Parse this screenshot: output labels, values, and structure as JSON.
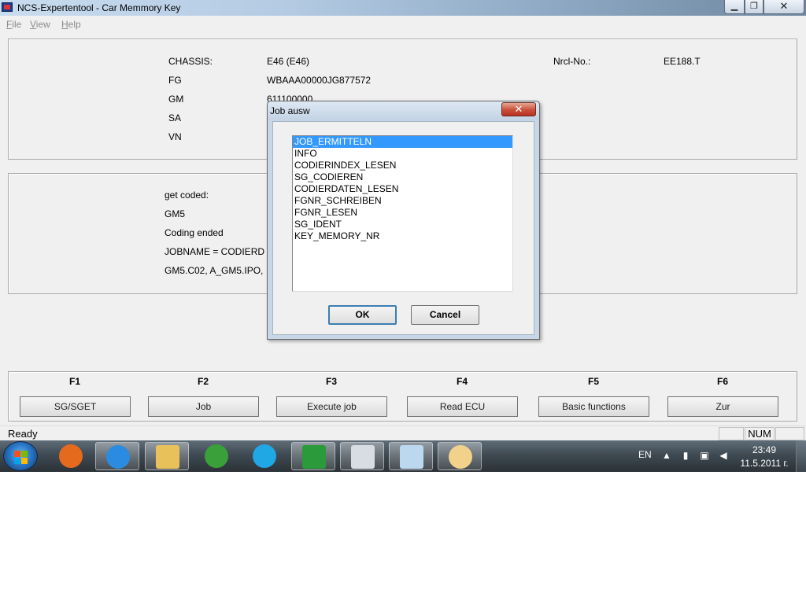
{
  "window": {
    "title": "NCS-Expertentool - Car Memmory Key",
    "min_glyph": "▁",
    "max_glyph": "❐",
    "close_glyph": "✕"
  },
  "menu": {
    "file": {
      "accel": "F",
      "rest": "ile"
    },
    "view": {
      "accel": "V",
      "rest": "iew"
    },
    "help": {
      "accel": "H",
      "rest": "elp"
    }
  },
  "vehicle_info": {
    "chassis_label": "CHASSIS:",
    "chassis_value": "E46 (E46)",
    "fg_label": "FG",
    "fg_value": "WBAAA00000JG877572",
    "gm_label": "GM",
    "gm_value": "611100000",
    "sa_label": "SA",
    "vn_label": "VN",
    "nrcl_label": "Nrcl-No.:",
    "nrcl_value": "EE188.T"
  },
  "log": {
    "line1": "get coded:",
    "line2": "GM5",
    "line3": "Coding ended",
    "line4": "JOBNAME = CODIERD",
    "line5": "GM5.C02, A_GM5.IPO,"
  },
  "function_keys": [
    {
      "key": "F1",
      "label": "SG/SGET"
    },
    {
      "key": "F2",
      "label": "Job"
    },
    {
      "key": "F3",
      "label": "Execute job"
    },
    {
      "key": "F4",
      "label": "Read ECU"
    },
    {
      "key": "F5",
      "label": "Basic functions"
    },
    {
      "key": "F6",
      "label": "Zur"
    }
  ],
  "status": {
    "text": "Ready",
    "num": "NUM"
  },
  "dialog": {
    "title": "Job ausw",
    "close_glyph": "✕",
    "selected_job": "JOB_ERMITTELN",
    "jobs": [
      "JOB_ERMITTELN",
      "INFO",
      "CODIERINDEX_LESEN",
      "SG_CODIEREN",
      "CODIERDATEN_LESEN",
      "FGNR_SCHREIBEN",
      "FGNR_LESEN",
      "SG_IDENT",
      "KEY_MEMORY_NR"
    ],
    "ok_label": "OK",
    "cancel_label": "Cancel"
  },
  "taskbar": {
    "apps": [
      "firefox-icon",
      "internet-explorer-icon",
      "explorer-folder-icon",
      "utorrent-icon",
      "skype-icon",
      "diagnostic-tool-icon",
      "calculator-icon",
      "notepad-icon",
      "paint-icon"
    ],
    "lang": "EN",
    "time": "23:49",
    "date": "11.5.2011 г.",
    "colors": {
      "firefox": "#e66a1e",
      "ie": "#2a8be0",
      "folder": "#e8c15a",
      "utorrent": "#3aa03a",
      "skype": "#1fa7e6",
      "diag": "#2a9a3a",
      "calc": "#d8dde3",
      "notepad": "#bcd8ef",
      "paint": "#f2d28a"
    }
  }
}
